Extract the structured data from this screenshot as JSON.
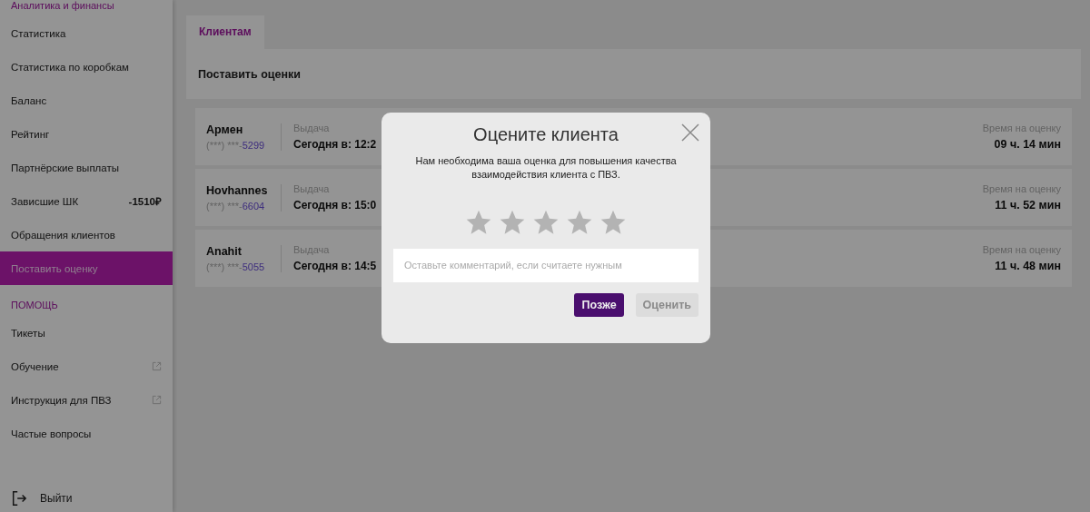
{
  "sidebar": {
    "sections": [
      {
        "title": "Аналитика и финансы",
        "items": [
          {
            "label": "Статистика",
            "selected": false
          },
          {
            "label": "Статистика по коробкам",
            "selected": false
          },
          {
            "label": "Баланс",
            "selected": false
          },
          {
            "label": "Рейтинг",
            "selected": false
          },
          {
            "label": "Партнёрские выплаты",
            "selected": false
          },
          {
            "label": "Зависшие ШК",
            "value": "-1510₽",
            "selected": false
          },
          {
            "label": "Обращения клиентов",
            "selected": false
          },
          {
            "label": "Поставить оценку",
            "selected": true
          }
        ]
      },
      {
        "title": "ПОМОЩЬ",
        "items": [
          {
            "label": "Тикеты",
            "selected": false
          },
          {
            "label": "Обучение",
            "external": true,
            "selected": false
          },
          {
            "label": "Инструкция для ПВЗ",
            "external": true,
            "selected": false
          },
          {
            "label": "Частые вопросы",
            "selected": false
          }
        ]
      }
    ],
    "logout": "Выйти"
  },
  "tabs": [
    {
      "label": "Клиентам",
      "selected": true
    }
  ],
  "section_title": "Поставить оценки",
  "clients": [
    {
      "name": "Армен",
      "phone_mask": "(***) ***-",
      "phone_last": "5299",
      "issue_label": "Выдача",
      "issue_time": "Сегодня в: 12:2",
      "timer_label": "Время на оценку",
      "timer": "09 ч. 14 мин"
    },
    {
      "name": "Hovhannes",
      "phone_mask": "(***) ***-",
      "phone_last": "6604",
      "issue_label": "Выдача",
      "issue_time": "Сегодня в: 15:0",
      "timer_label": "Время на оценку",
      "timer": "11 ч. 52 мин"
    },
    {
      "name": "Anahit",
      "phone_mask": "(***) ***-",
      "phone_last": "5055",
      "issue_label": "Выдача",
      "issue_time": "Сегодня в: 14:5",
      "timer_label": "Время на оценку",
      "timer": "11 ч. 48 мин"
    }
  ],
  "dialog": {
    "title": "Оцените клиента",
    "text": "Нам необходима ваша оценка для повышения качества взаимодействия клиента с ПВЗ.",
    "stars": 0,
    "comment": {
      "placeholder": "Оставьте комментарий, если считаете нужным"
    },
    "buttons": [
      {
        "label": "Позже",
        "disabled": false
      },
      {
        "label": "Оценить",
        "disabled": true
      }
    ]
  }
}
